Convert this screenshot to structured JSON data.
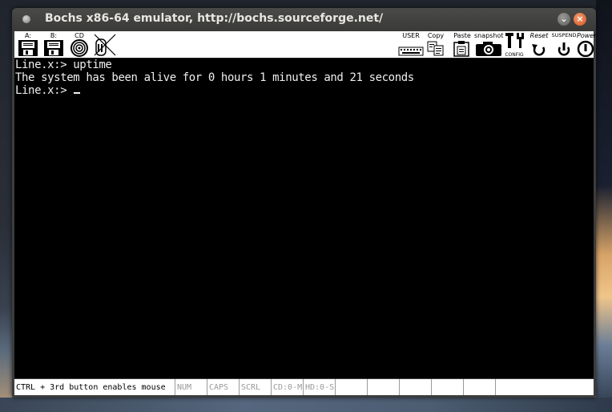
{
  "window": {
    "title": "Bochs x86-64 emulator, http://bochs.sourceforge.net/",
    "minimize_glyph": "⌄",
    "close_glyph": "×"
  },
  "toolbar": {
    "left_items": [
      {
        "label": "A:",
        "icon": "floppy-a-icon"
      },
      {
        "label": "B:",
        "icon": "floppy-b-icon"
      },
      {
        "label": "CD",
        "icon": "cdrom-icon"
      },
      {
        "label": "",
        "icon": "mouse-disabled-icon"
      }
    ],
    "right_items": [
      {
        "label": "USER",
        "icon": "user-keyboard-icon"
      },
      {
        "label": "Copy",
        "icon": "copy-icon"
      },
      {
        "label": "Paste",
        "icon": "paste-icon"
      },
      {
        "label": "snapshot",
        "icon": "snapshot-camera-icon"
      },
      {
        "label": "CONFIG",
        "icon": "config-tools-icon"
      },
      {
        "label": "Reset",
        "icon": "reset-icon"
      },
      {
        "label": "SUSPEND",
        "icon": "suspend-icon"
      },
      {
        "label": "Power",
        "icon": "power-icon"
      }
    ]
  },
  "terminal": {
    "lines": [
      "Line.x:> uptime",
      "The system has been alive for 0 hours 1 minutes and 21 seconds",
      "Line.x:> "
    ]
  },
  "statusbar": {
    "message": "CTRL + 3rd button enables mouse",
    "indicators": [
      "NUM",
      "CAPS",
      "SCRL",
      "CD:0-M",
      "HD:0-S",
      "",
      "",
      "",
      "",
      "",
      ""
    ]
  },
  "colors": {
    "terminal_bg": "#000000",
    "terminal_fg": "#f0f0f0",
    "close_button": "#e05a20",
    "titlebar": "#3c3c3c"
  }
}
